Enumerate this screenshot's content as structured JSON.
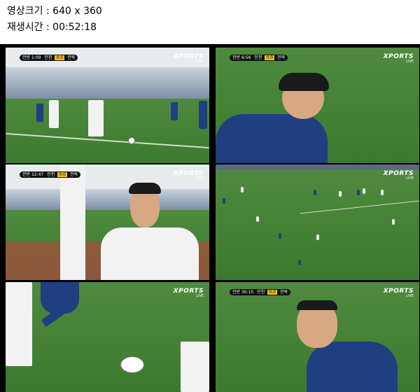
{
  "info": {
    "resolution_label": "영상크기",
    "resolution_value": "640 x 360",
    "runtime_label": "재생시간",
    "runtime_value": "00:52:18"
  },
  "broadcast": {
    "logo_main": "XPORTS",
    "logo_sub": "LIVE"
  },
  "frames": [
    {
      "time": "전반 1:09",
      "home": "인천",
      "score": "0:0",
      "away": "전북"
    },
    {
      "time": "전반 6:56",
      "home": "인천",
      "score": "0:0",
      "away": "전북"
    },
    {
      "time": "전반 12:47",
      "home": "인천",
      "score": "0:0",
      "away": "전북"
    },
    {
      "time": "",
      "home": "",
      "score": "",
      "away": ""
    },
    {
      "time": "",
      "home": "",
      "score": "",
      "away": ""
    },
    {
      "time": "전반 30:15",
      "home": "인천",
      "score": "0:0",
      "away": "전북"
    }
  ]
}
